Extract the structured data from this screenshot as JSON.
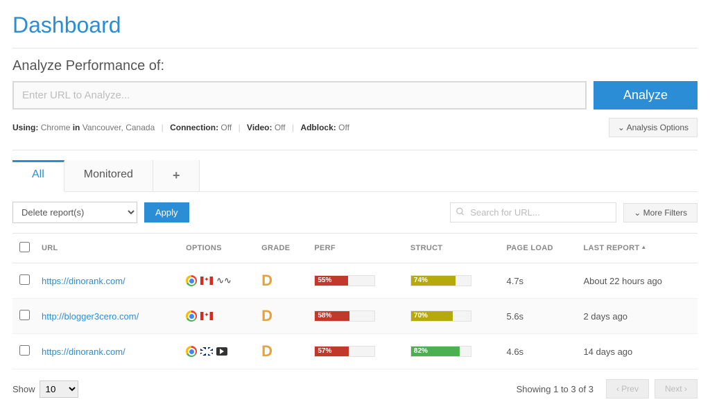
{
  "page_title": "Dashboard",
  "analyze": {
    "label": "Analyze Performance of:",
    "placeholder": "Enter URL to Analyze...",
    "button": "Analyze"
  },
  "meta": {
    "using_label": "Using:",
    "browser": "Chrome",
    "in_label": "in",
    "location": "Vancouver, Canada",
    "connection_label": "Connection:",
    "connection_value": "Off",
    "video_label": "Video:",
    "video_value": "Off",
    "adblock_label": "Adblock:",
    "adblock_value": "Off",
    "options_button": "Analysis Options"
  },
  "tabs": {
    "all": "All",
    "monitored": "Monitored"
  },
  "toolbar": {
    "bulk_action": "Delete report(s)",
    "apply": "Apply",
    "search_placeholder": "Search for URL...",
    "more_filters": "More Filters"
  },
  "columns": {
    "url": "URL",
    "options": "OPTIONS",
    "grade": "GRADE",
    "perf": "PERF",
    "struct": "STRUCT",
    "page_load": "PAGE LOAD",
    "last_report": "LAST REPORT"
  },
  "rows": [
    {
      "url": "https://dinorank.com/",
      "icons": [
        "chrome",
        "ca",
        "pulse"
      ],
      "grade": "D",
      "perf": 55,
      "perf_color": "red",
      "struct": 74,
      "struct_color": "olive",
      "page_load": "4.7s",
      "last_report": "About 22 hours ago"
    },
    {
      "url": "http://blogger3cero.com/",
      "icons": [
        "chrome",
        "ca"
      ],
      "grade": "D",
      "perf": 58,
      "perf_color": "red",
      "struct": 70,
      "struct_color": "olive",
      "page_load": "5.6s",
      "last_report": "2 days ago"
    },
    {
      "url": "https://dinorank.com/",
      "icons": [
        "chrome",
        "uk",
        "yt"
      ],
      "grade": "D",
      "perf": 57,
      "perf_color": "red",
      "struct": 82,
      "struct_color": "green",
      "page_load": "4.6s",
      "last_report": "14 days ago"
    }
  ],
  "footer": {
    "show_label": "Show",
    "per_page": "10",
    "showing": "Showing 1 to 3 of 3",
    "prev": "Prev",
    "next": "Next"
  }
}
